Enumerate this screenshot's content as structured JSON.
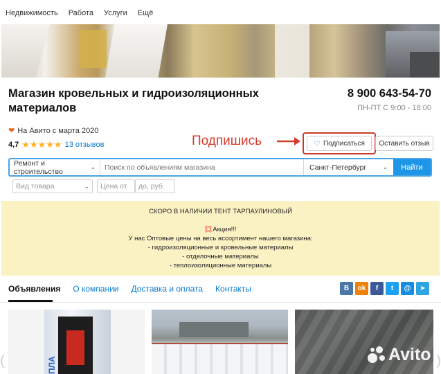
{
  "topnav": [
    "Недвижимость",
    "Работа",
    "Услуги",
    "Ещё"
  ],
  "shop": {
    "title": "Магазин кровельных и гидроизоляционных материалов",
    "phone": "8 900 643-54-70",
    "hours": "ПН-ПТ С 9:00 - 18:00",
    "since": "На Авито с марта 2020",
    "rating": "4,7",
    "stars": "★★★★★",
    "reviews": "13 отзывов"
  },
  "annotation": "Подпишись",
  "buttons": {
    "subscribe": "Подписаться",
    "review": "Оставить отзыв"
  },
  "search": {
    "category": "Ремонт и строительство",
    "placeholder": "Поиск по объявлениям магазина",
    "city": "Санкт-Петербург",
    "button": "Найти"
  },
  "filters": {
    "type_placeholder": "Вид товара",
    "price_from": "Цена от",
    "price_to": "до, руб."
  },
  "announcement": {
    "line1": "СКОРО В НАЛИЧИИ ТЕНТ ТАРПАУЛИНОВЫЙ",
    "line2": "💢Акция!!!",
    "line3": "У нас Оптовые цены на весь ассортимент нашего магазина:",
    "line4": "- гидроизоляционные и кровельные материалы",
    "line5": "- отделочные материалы",
    "line6": "- теплоизоляционные материалы"
  },
  "tabs": [
    "Объявления",
    "О компании",
    "Доставка и оплата",
    "Контакты"
  ],
  "social": [
    {
      "name": "vk",
      "glyph": "В",
      "color": "#4a76a8"
    },
    {
      "name": "odnoklassniki",
      "glyph": "ok",
      "color": "#ee8208"
    },
    {
      "name": "facebook",
      "glyph": "f",
      "color": "#3b5998"
    },
    {
      "name": "twitter",
      "glyph": "t",
      "color": "#1da1f2"
    },
    {
      "name": "mail",
      "glyph": "@",
      "color": "#168de2"
    },
    {
      "name": "telegram",
      "glyph": "➤",
      "color": "#2ca5e0"
    }
  ],
  "watermark": "Avito",
  "colors": {
    "accent": "#1e96e8",
    "link": "#0a7bcc",
    "annotation": "#d63c2e",
    "announce_bg": "#fbf2c4",
    "stars": "#ffb021"
  }
}
